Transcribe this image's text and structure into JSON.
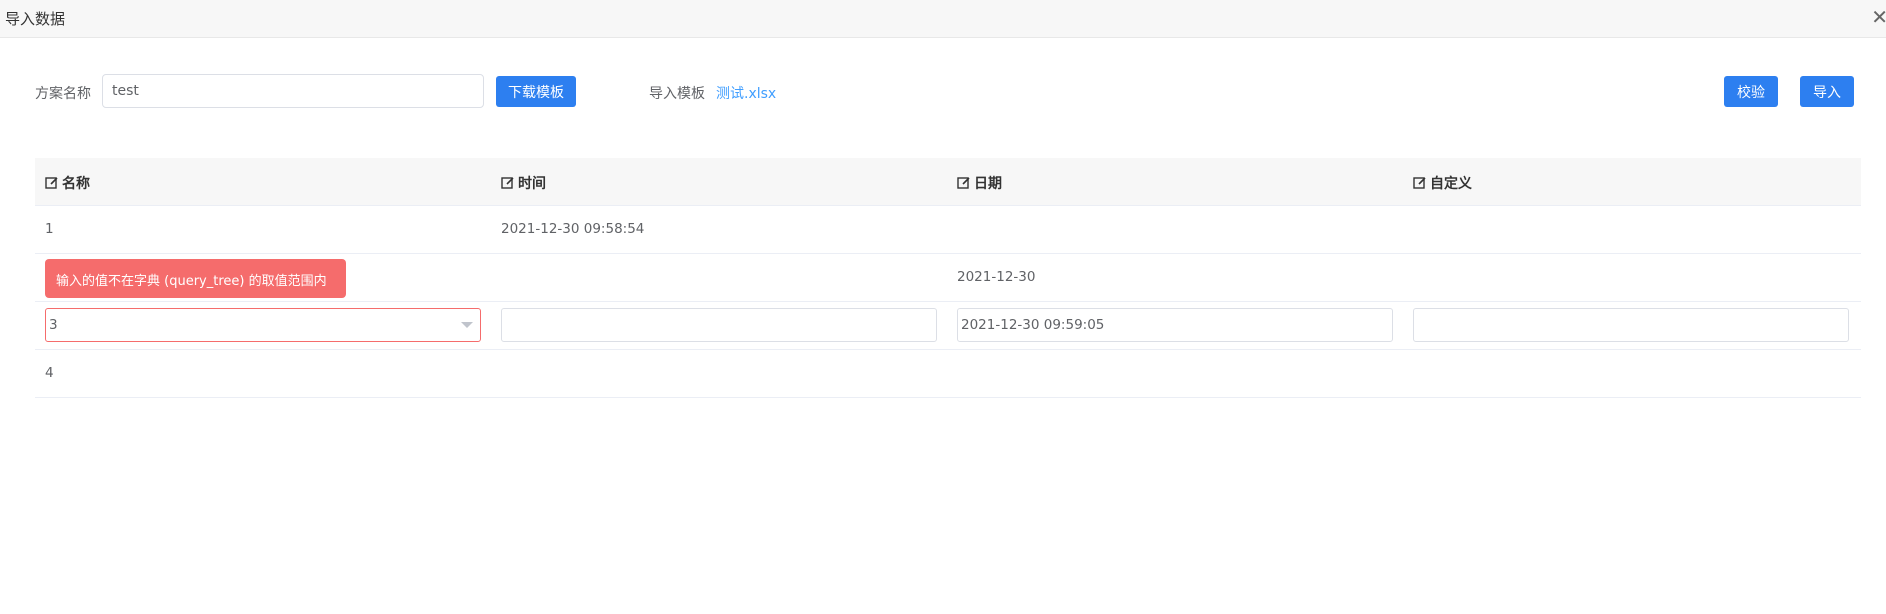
{
  "dialog": {
    "title": "导入数据",
    "close_icon": "close-icon"
  },
  "form": {
    "scheme_label": "方案名称",
    "scheme_value": "test",
    "download_button": "下载模板",
    "template_label": "导入模板",
    "template_file": "测试.xlsx",
    "validate_button": "校验",
    "import_button": "导入"
  },
  "table": {
    "columns": [
      "名称",
      "时间",
      "日期",
      "自定义"
    ],
    "column_icon": "edit-icon",
    "rows": [
      {
        "name": "1",
        "time": "2021-12-30 09:58:54",
        "date": "",
        "custom": ""
      },
      {
        "name": "",
        "time": "",
        "date": "2021-12-30",
        "custom": ""
      },
      {
        "name": "3",
        "time": "",
        "date": "2021-12-30 09:59:05",
        "custom": ""
      },
      {
        "name": "4",
        "time": "",
        "date": "",
        "custom": ""
      }
    ]
  },
  "validation": {
    "error_message": "输入的值不在字典 (query_tree) 的取值范围内",
    "error_color": "#f56c6c"
  },
  "colors": {
    "primary": "#2d7ff0",
    "link": "#409eff"
  }
}
